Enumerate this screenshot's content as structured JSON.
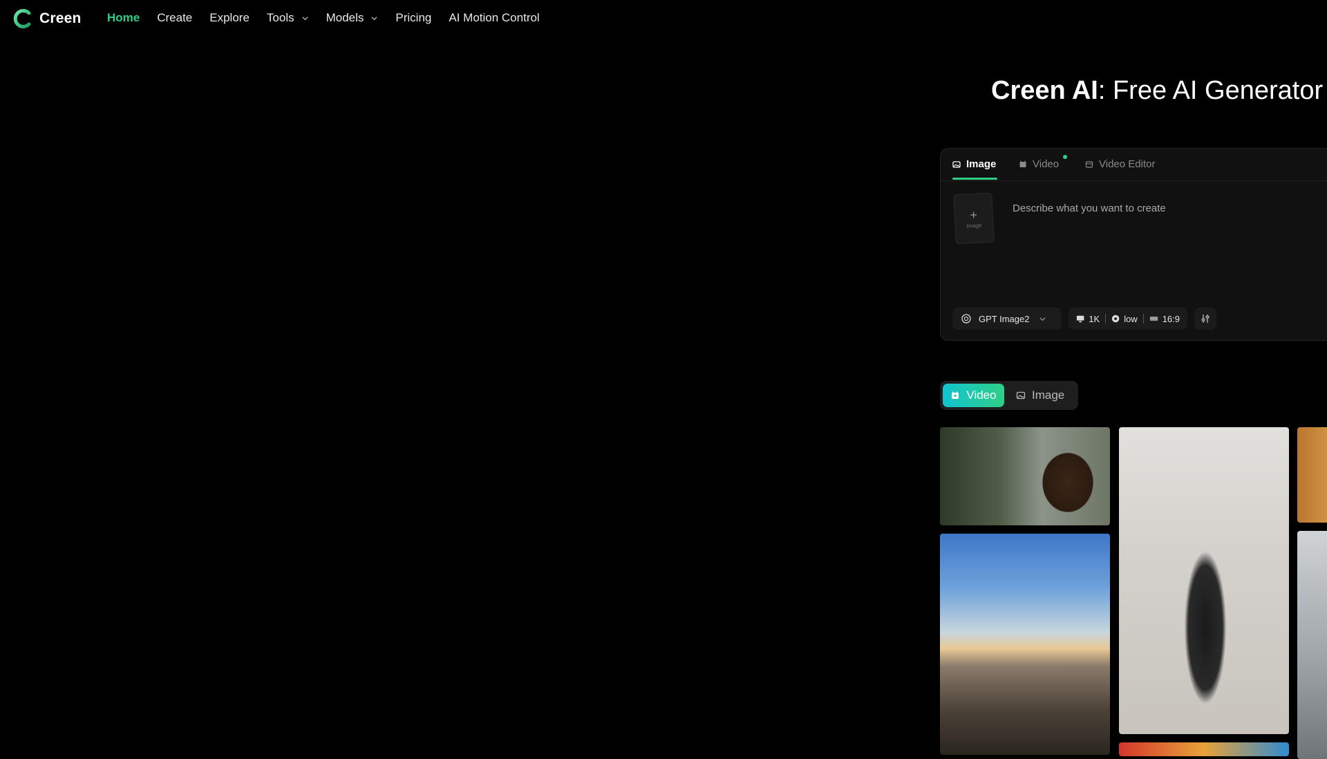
{
  "header": {
    "logo_text": "Creen",
    "nav": [
      {
        "label": "Home",
        "active": true
      },
      {
        "label": "Create"
      },
      {
        "label": "Explore"
      },
      {
        "label": "Tools",
        "dropdown": true
      },
      {
        "label": "Models",
        "dropdown": true
      },
      {
        "label": "Pricing"
      },
      {
        "label": "AI Motion Control"
      }
    ]
  },
  "hero": {
    "brand": "Creen AI",
    "title_rest": ": Free AI Generator"
  },
  "generator": {
    "tabs": [
      {
        "label": "Image",
        "active": true,
        "icon": "image-icon"
      },
      {
        "label": "Video",
        "icon": "video-icon",
        "new_dot": true
      },
      {
        "label": "Video Editor",
        "icon": "video-editor-icon"
      }
    ],
    "upload_label": "Image",
    "prompt_placeholder": "Describe what you want to create",
    "model": "GPT Image2",
    "resolution": "1K",
    "quality": "low",
    "aspect_ratio": "16:9"
  },
  "gallery_toggle": {
    "video_label": "Video",
    "image_label": "Image",
    "active": "Video"
  },
  "gallery": {
    "items": [
      {
        "name": "gallery-bigfoot-thumb"
      },
      {
        "name": "gallery-city-skyline-thumb"
      },
      {
        "name": "gallery-portrait-thumb"
      }
    ]
  },
  "colors": {
    "accent": "#2fcf87",
    "accent_gradient_start": "#12c3cf",
    "background": "#000000",
    "panel": "#111111"
  }
}
